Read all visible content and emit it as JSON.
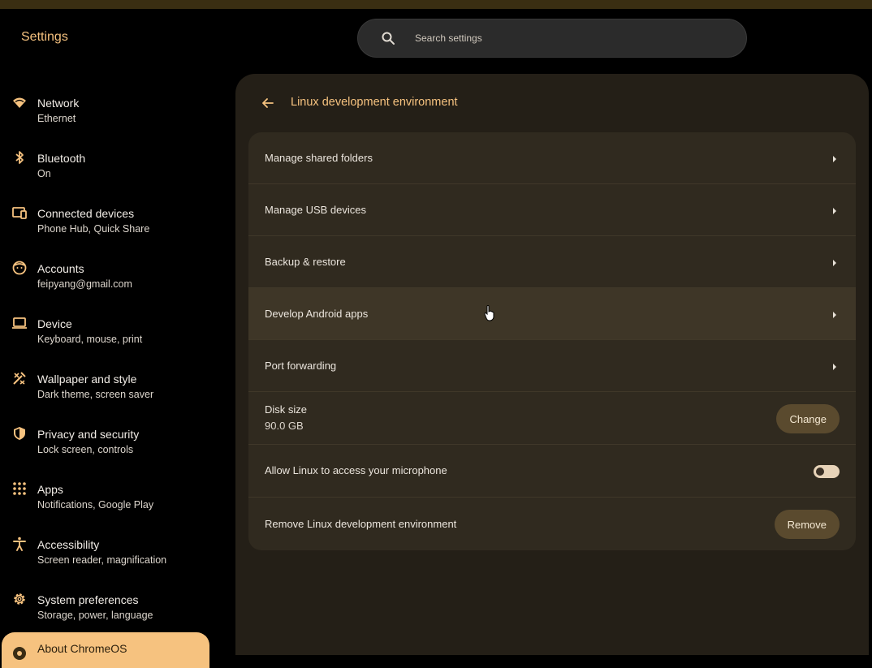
{
  "app": {
    "title": "Settings"
  },
  "search": {
    "placeholder": "Search settings"
  },
  "colors": {
    "accent": "#f6c27f",
    "panel": "#241f17",
    "card": "#302a1f"
  },
  "sidebar": {
    "items": [
      {
        "title": "Network",
        "subtitle": "Ethernet",
        "icon": "wifi-icon"
      },
      {
        "title": "Bluetooth",
        "subtitle": "On",
        "icon": "bluetooth-icon"
      },
      {
        "title": "Connected devices",
        "subtitle": "Phone Hub, Quick Share",
        "icon": "devices-icon"
      },
      {
        "title": "Accounts",
        "subtitle": "feipyang@gmail.com",
        "icon": "account-icon"
      },
      {
        "title": "Device",
        "subtitle": "Keyboard, mouse, print",
        "icon": "laptop-icon"
      },
      {
        "title": "Wallpaper and style",
        "subtitle": "Dark theme, screen saver",
        "icon": "palette-icon"
      },
      {
        "title": "Privacy and security",
        "subtitle": "Lock screen, controls",
        "icon": "shield-icon"
      },
      {
        "title": "Apps",
        "subtitle": "Notifications, Google Play",
        "icon": "apps-grid-icon"
      },
      {
        "title": "Accessibility",
        "subtitle": "Screen reader, magnification",
        "icon": "accessibility-icon"
      },
      {
        "title": "System preferences",
        "subtitle": "Storage, power, language",
        "icon": "gear-icon"
      },
      {
        "title": "About ChromeOS",
        "subtitle": "",
        "icon": "chromeos-icon"
      }
    ]
  },
  "page": {
    "title": "Linux development environment",
    "rows": [
      {
        "label": "Manage shared folders"
      },
      {
        "label": "Manage USB devices"
      },
      {
        "label": "Backup & restore"
      },
      {
        "label": "Develop Android apps"
      },
      {
        "label": "Port forwarding"
      }
    ],
    "disk": {
      "label": "Disk size",
      "value": "90.0 GB",
      "button": "Change"
    },
    "microphone": {
      "label": "Allow Linux to access your microphone",
      "enabled": false
    },
    "remove": {
      "label": "Remove Linux development environment",
      "button": "Remove"
    }
  }
}
